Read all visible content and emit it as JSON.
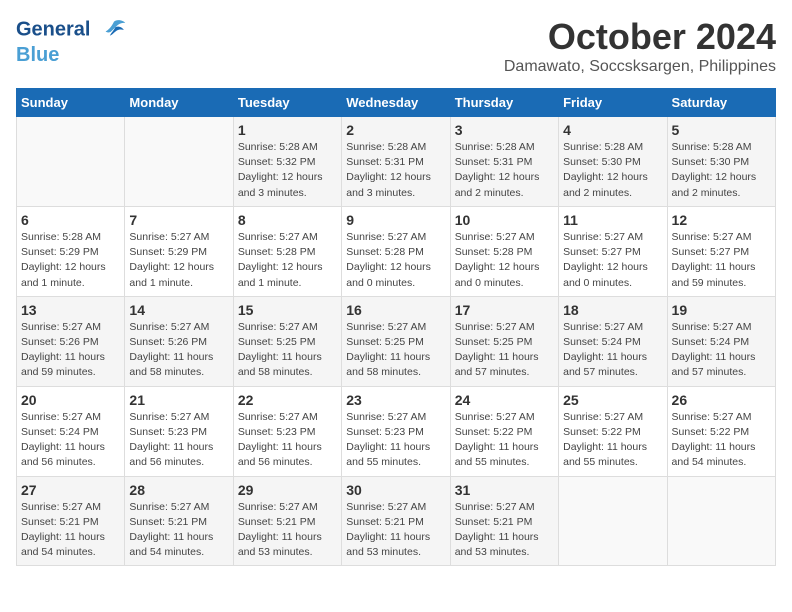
{
  "logo": {
    "line1": "General",
    "line2": "Blue"
  },
  "title": "October 2024",
  "location": "Damawato, Soccsksargen, Philippines",
  "days_of_week": [
    "Sunday",
    "Monday",
    "Tuesday",
    "Wednesday",
    "Thursday",
    "Friday",
    "Saturday"
  ],
  "weeks": [
    [
      {
        "day": "",
        "info": ""
      },
      {
        "day": "",
        "info": ""
      },
      {
        "day": "1",
        "info": "Sunrise: 5:28 AM\nSunset: 5:32 PM\nDaylight: 12 hours\nand 3 minutes."
      },
      {
        "day": "2",
        "info": "Sunrise: 5:28 AM\nSunset: 5:31 PM\nDaylight: 12 hours\nand 3 minutes."
      },
      {
        "day": "3",
        "info": "Sunrise: 5:28 AM\nSunset: 5:31 PM\nDaylight: 12 hours\nand 2 minutes."
      },
      {
        "day": "4",
        "info": "Sunrise: 5:28 AM\nSunset: 5:30 PM\nDaylight: 12 hours\nand 2 minutes."
      },
      {
        "day": "5",
        "info": "Sunrise: 5:28 AM\nSunset: 5:30 PM\nDaylight: 12 hours\nand 2 minutes."
      }
    ],
    [
      {
        "day": "6",
        "info": "Sunrise: 5:28 AM\nSunset: 5:29 PM\nDaylight: 12 hours\nand 1 minute."
      },
      {
        "day": "7",
        "info": "Sunrise: 5:27 AM\nSunset: 5:29 PM\nDaylight: 12 hours\nand 1 minute."
      },
      {
        "day": "8",
        "info": "Sunrise: 5:27 AM\nSunset: 5:28 PM\nDaylight: 12 hours\nand 1 minute."
      },
      {
        "day": "9",
        "info": "Sunrise: 5:27 AM\nSunset: 5:28 PM\nDaylight: 12 hours\nand 0 minutes."
      },
      {
        "day": "10",
        "info": "Sunrise: 5:27 AM\nSunset: 5:28 PM\nDaylight: 12 hours\nand 0 minutes."
      },
      {
        "day": "11",
        "info": "Sunrise: 5:27 AM\nSunset: 5:27 PM\nDaylight: 12 hours\nand 0 minutes."
      },
      {
        "day": "12",
        "info": "Sunrise: 5:27 AM\nSunset: 5:27 PM\nDaylight: 11 hours\nand 59 minutes."
      }
    ],
    [
      {
        "day": "13",
        "info": "Sunrise: 5:27 AM\nSunset: 5:26 PM\nDaylight: 11 hours\nand 59 minutes."
      },
      {
        "day": "14",
        "info": "Sunrise: 5:27 AM\nSunset: 5:26 PM\nDaylight: 11 hours\nand 58 minutes."
      },
      {
        "day": "15",
        "info": "Sunrise: 5:27 AM\nSunset: 5:25 PM\nDaylight: 11 hours\nand 58 minutes."
      },
      {
        "day": "16",
        "info": "Sunrise: 5:27 AM\nSunset: 5:25 PM\nDaylight: 11 hours\nand 58 minutes."
      },
      {
        "day": "17",
        "info": "Sunrise: 5:27 AM\nSunset: 5:25 PM\nDaylight: 11 hours\nand 57 minutes."
      },
      {
        "day": "18",
        "info": "Sunrise: 5:27 AM\nSunset: 5:24 PM\nDaylight: 11 hours\nand 57 minutes."
      },
      {
        "day": "19",
        "info": "Sunrise: 5:27 AM\nSunset: 5:24 PM\nDaylight: 11 hours\nand 57 minutes."
      }
    ],
    [
      {
        "day": "20",
        "info": "Sunrise: 5:27 AM\nSunset: 5:24 PM\nDaylight: 11 hours\nand 56 minutes."
      },
      {
        "day": "21",
        "info": "Sunrise: 5:27 AM\nSunset: 5:23 PM\nDaylight: 11 hours\nand 56 minutes."
      },
      {
        "day": "22",
        "info": "Sunrise: 5:27 AM\nSunset: 5:23 PM\nDaylight: 11 hours\nand 56 minutes."
      },
      {
        "day": "23",
        "info": "Sunrise: 5:27 AM\nSunset: 5:23 PM\nDaylight: 11 hours\nand 55 minutes."
      },
      {
        "day": "24",
        "info": "Sunrise: 5:27 AM\nSunset: 5:22 PM\nDaylight: 11 hours\nand 55 minutes."
      },
      {
        "day": "25",
        "info": "Sunrise: 5:27 AM\nSunset: 5:22 PM\nDaylight: 11 hours\nand 55 minutes."
      },
      {
        "day": "26",
        "info": "Sunrise: 5:27 AM\nSunset: 5:22 PM\nDaylight: 11 hours\nand 54 minutes."
      }
    ],
    [
      {
        "day": "27",
        "info": "Sunrise: 5:27 AM\nSunset: 5:21 PM\nDaylight: 11 hours\nand 54 minutes."
      },
      {
        "day": "28",
        "info": "Sunrise: 5:27 AM\nSunset: 5:21 PM\nDaylight: 11 hours\nand 54 minutes."
      },
      {
        "day": "29",
        "info": "Sunrise: 5:27 AM\nSunset: 5:21 PM\nDaylight: 11 hours\nand 53 minutes."
      },
      {
        "day": "30",
        "info": "Sunrise: 5:27 AM\nSunset: 5:21 PM\nDaylight: 11 hours\nand 53 minutes."
      },
      {
        "day": "31",
        "info": "Sunrise: 5:27 AM\nSunset: 5:21 PM\nDaylight: 11 hours\nand 53 minutes."
      },
      {
        "day": "",
        "info": ""
      },
      {
        "day": "",
        "info": ""
      }
    ]
  ]
}
